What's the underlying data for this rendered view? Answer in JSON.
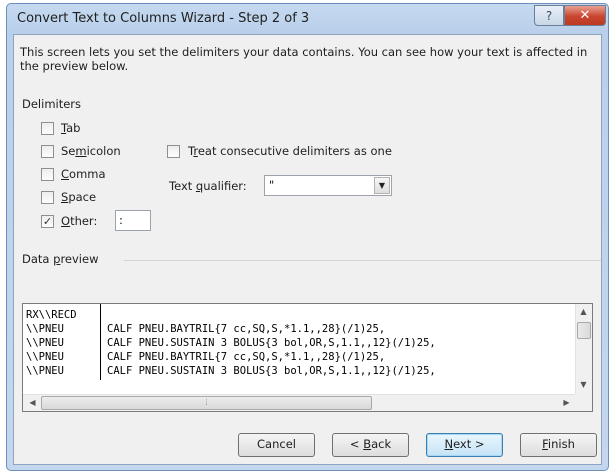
{
  "window": {
    "title": "Convert Text to Columns Wizard - Step 2 of 3",
    "help_label": "?",
    "close_label": "✕"
  },
  "description": "This screen lets you set the delimiters your data contains.  You can see how your text is affected in the preview below.",
  "delimiters": {
    "group_label": "Delimiters",
    "tab": {
      "label": "Tab",
      "checked": false
    },
    "semicolon": {
      "label": "Semicolon",
      "checked": false
    },
    "comma": {
      "label": "Comma",
      "checked": false
    },
    "space": {
      "label": "Space",
      "checked": false
    },
    "other": {
      "label": "Other:",
      "checked": true,
      "value": ":"
    }
  },
  "consecutive": {
    "label": "Treat consecutive delimiters as one",
    "checked": false
  },
  "qualifier": {
    "label": "Text qualifier:",
    "value": "\""
  },
  "preview": {
    "label": "Data preview",
    "rows": [
      [
        "RX\\\\RECD",
        ""
      ],
      [
        "\\\\PNEU",
        "CALF PNEU.BAYTRIL{7 cc,SQ,S,*1.1,,28}(/1)25,"
      ],
      [
        "\\\\PNEU",
        "CALF PNEU.SUSTAIN 3 BOLUS{3 bol,OR,S,1.1,,12}(/1)25,"
      ],
      [
        "\\\\PNEU",
        "CALF PNEU.BAYTRIL{7 cc,SQ,S,*1.1,,28}(/1)25,"
      ],
      [
        "\\\\PNEU",
        "CALF PNEU.SUSTAIN 3 BOLUS{3 bol,OR,S,1.1,,12}(/1)25,"
      ]
    ]
  },
  "buttons": {
    "cancel": "Cancel",
    "back": "< Back",
    "next": "Next >",
    "finish": "Finish"
  }
}
